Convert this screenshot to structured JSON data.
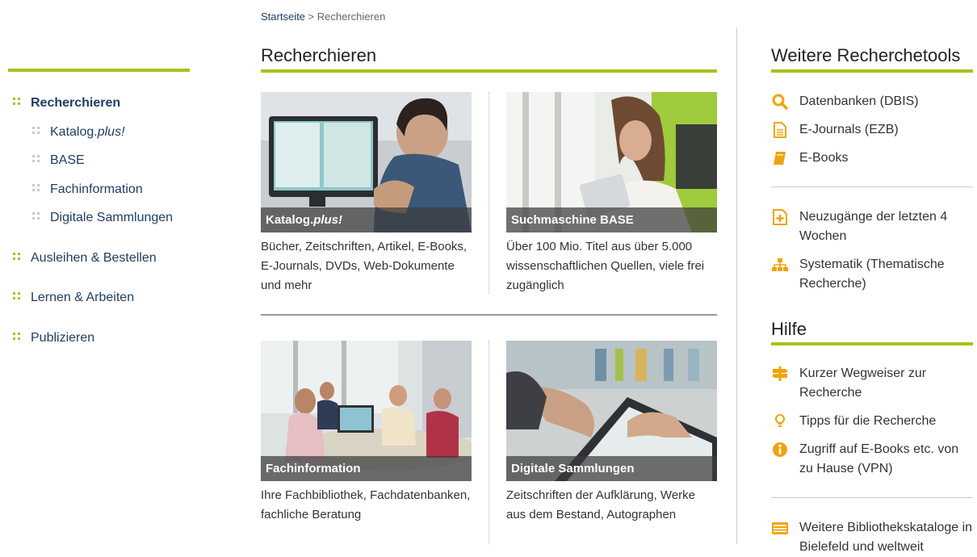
{
  "breadcrumb": {
    "home": "Startseite",
    "separator": " > ",
    "current": "Recherchieren"
  },
  "nav": {
    "main": {
      "label": "Recherchieren"
    },
    "sub": [
      {
        "label": "Katalog.",
        "label_em": "plus!"
      },
      {
        "label": "BASE"
      },
      {
        "label": "Fachinformation"
      },
      {
        "label": "Digitale Sammlungen"
      }
    ],
    "sections": [
      {
        "label": "Ausleihen & Bestellen"
      },
      {
        "label": "Lernen & Arbeiten"
      },
      {
        "label": "Publizieren"
      }
    ]
  },
  "main": {
    "title": "Recherchieren",
    "cards": [
      {
        "caption": "Katalog.",
        "caption_em": "plus!",
        "desc": "Bücher, Zeitschriften, Artikel, E-Books, E-Journals, DVDs, Web-Dokumente und mehr"
      },
      {
        "caption": "Suchmaschine BASE",
        "desc": "Über 100 Mio. Titel aus über 5.000 wissenschaftlichen Quellen, viele frei zugänglich"
      },
      {
        "caption": "Fachinformation",
        "desc": "Ihre Fachbibliothek, Fachdatenbanken, fachliche Beratung"
      },
      {
        "caption": "Digitale Sammlungen",
        "desc": "Zeitschriften der Aufklärung, Werke aus dem Bestand, Autographen"
      }
    ]
  },
  "sidebar": {
    "tools_title": "Weitere Recherchetools",
    "tools": [
      {
        "label": "Datenbanken (DBIS)",
        "icon": "search-icon"
      },
      {
        "label": "E-Journals (EZB)",
        "icon": "document-icon"
      },
      {
        "label": "E-Books",
        "icon": "book-icon"
      }
    ],
    "tools2": [
      {
        "label": "Neuzugänge der letzten 4 Wochen",
        "icon": "plus-box-icon"
      },
      {
        "label": "Systematik (Thematische Recherche)",
        "icon": "sitemap-icon"
      }
    ],
    "help_title": "Hilfe",
    "help": [
      {
        "label": "Kurzer Wegweiser zur Recherche",
        "icon": "signpost-icon"
      },
      {
        "label": "Tipps für die Recherche",
        "icon": "lightbulb-icon"
      },
      {
        "label": "Zugriff auf E-Books etc. von zu Hause (VPN)",
        "icon": "info-icon"
      }
    ],
    "extra": [
      {
        "label": "Weitere Bibliothekskataloge in Bielefeld und weltweit",
        "icon": "list-card-icon"
      }
    ]
  },
  "colors": {
    "accent": "#a8c21a",
    "icon": "#f0a30a",
    "nav": "#1f3d66"
  }
}
